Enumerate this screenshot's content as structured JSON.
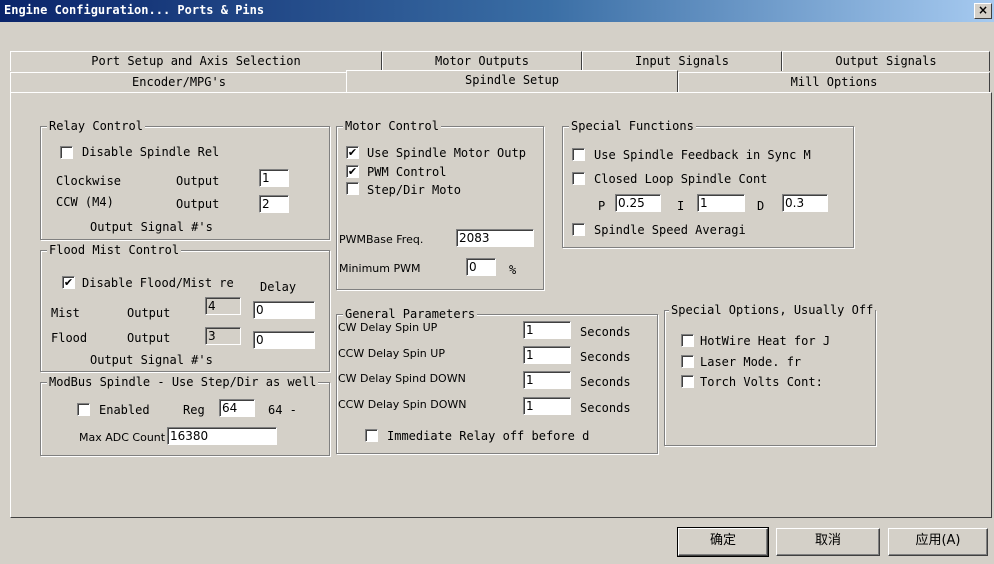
{
  "window": {
    "title": "Engine Configuration... Ports & Pins",
    "close": "×"
  },
  "tabs": {
    "row1": [
      "Port Setup and Axis Selection",
      "Motor Outputs",
      "Input Signals",
      "Output Signals"
    ],
    "row2": [
      "Encoder/MPG's",
      "Spindle Setup",
      "Mill Options"
    ],
    "active": "Spindle Setup"
  },
  "relay": {
    "title": "Relay Control",
    "disable_label": "Disable Spindle Rel",
    "disable_checked": "",
    "cw_label": "Clockwise",
    "cw_output": "Output",
    "cw_value": "1",
    "ccw_label": "CCW (M4)",
    "ccw_output": "Output",
    "ccw_value": "2",
    "footer": "Output Signal #'s"
  },
  "flood": {
    "title": "Flood Mist Control",
    "disable_label": "Disable Flood/Mist re",
    "disable_checked": "✔",
    "delay_label": "Delay",
    "mist_label": "Mist",
    "mist_output": "Output",
    "mist_value": "4",
    "mist_delay": "0",
    "flood_label": "Flood",
    "flood_output": "Output",
    "flood_value": "3",
    "flood_delay": "0",
    "footer": "Output Signal #'s"
  },
  "modbus": {
    "title": "ModBus Spindle - Use Step/Dir as well",
    "enabled_label": "Enabled",
    "enabled_checked": "",
    "reg_label": "Reg",
    "reg_value": "64",
    "reg_suffix": "64 -",
    "adc_label": "Max ADC Count",
    "adc_value": "16380"
  },
  "motor": {
    "title": "Motor Control",
    "use_label": "Use Spindle Motor Outp",
    "use_checked": "✔",
    "pwm_label": "PWM Control",
    "pwm_checked": "✔",
    "step_label": "Step/Dir Moto",
    "step_checked": "",
    "base_label": "PWMBase Freq.",
    "base_value": "2083",
    "min_label": "Minimum PWM",
    "min_value": "0",
    "min_unit": "%"
  },
  "general": {
    "title": "General Parameters",
    "rows": [
      {
        "label": "CW Delay Spin UP",
        "value": "1",
        "unit": "Seconds"
      },
      {
        "label": "CCW Delay Spin UP",
        "value": "1",
        "unit": "Seconds"
      },
      {
        "label": "CW Delay Spind DOWN",
        "value": "1",
        "unit": "Seconds"
      },
      {
        "label": "CCW Delay Spin DOWN",
        "value": "1",
        "unit": "Seconds"
      }
    ],
    "immediate_label": "Immediate Relay off before d",
    "immediate_checked": ""
  },
  "special": {
    "title": "Special Functions",
    "feedback_label": "Use Spindle Feedback in Sync M",
    "feedback_checked": "",
    "closed_label": "Closed Loop Spindle Cont",
    "closed_checked": "",
    "p_label": "P",
    "p_value": "0.25",
    "i_label": "I",
    "i_value": "1",
    "d_label": "D",
    "d_value": "0.3",
    "avg_label": "Spindle Speed Averagi",
    "avg_checked": ""
  },
  "options": {
    "title": "Special Options, Usually Off",
    "hotwire_label": "HotWire Heat for J",
    "hotwire_checked": "",
    "laser_label": "Laser Mode. fr",
    "laser_checked": "",
    "torch_label": "Torch Volts Cont:",
    "torch_checked": ""
  },
  "buttons": {
    "ok": "确定",
    "cancel": "取消",
    "apply": "应用(A)"
  }
}
